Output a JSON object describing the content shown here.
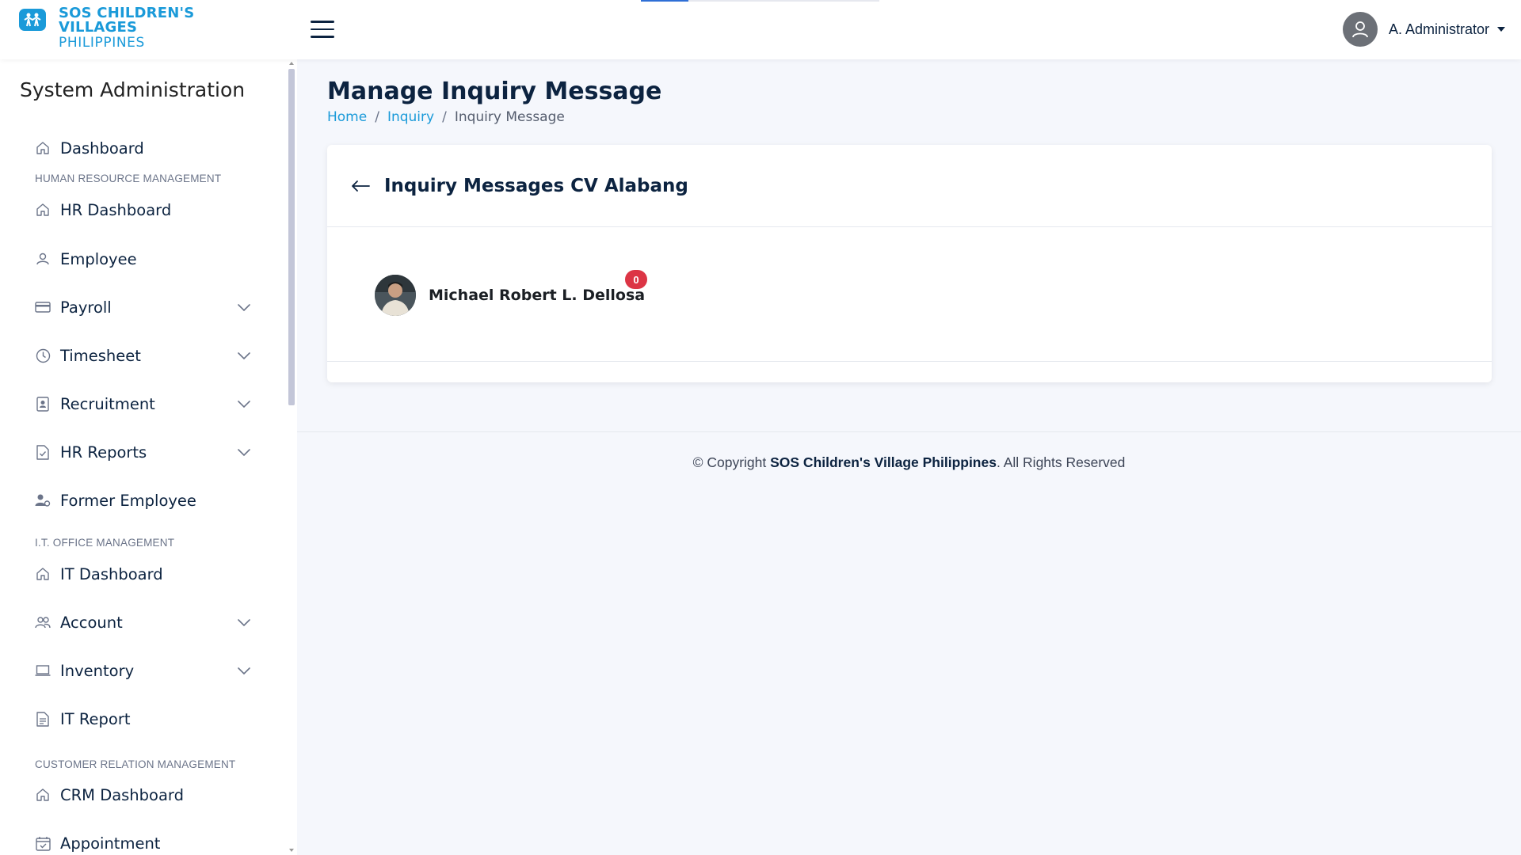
{
  "header": {
    "logo": {
      "line1": "SOS CHILDREN'S",
      "line2": "VILLAGES",
      "line3": "PHILIPPINES"
    },
    "user_name": "A. Administrator",
    "progress_fraction": 0.2
  },
  "sidebar": {
    "title": "System Administration",
    "items": [
      {
        "label": "Dashboard",
        "icon": "home-icon",
        "expandable": false
      },
      {
        "section": "HUMAN RESOURCE MANAGEMENT"
      },
      {
        "label": "HR Dashboard",
        "icon": "home-icon",
        "expandable": false
      },
      {
        "label": "Employee",
        "icon": "user-icon",
        "expandable": false
      },
      {
        "label": "Payroll",
        "icon": "credit-card-icon",
        "expandable": true
      },
      {
        "label": "Timesheet",
        "icon": "clock-icon",
        "expandable": true
      },
      {
        "label": "Recruitment",
        "icon": "id-badge-icon",
        "expandable": true
      },
      {
        "label": "HR Reports",
        "icon": "file-check-icon",
        "expandable": true
      },
      {
        "label": "Former Employee",
        "icon": "user-gear-icon",
        "expandable": false
      },
      {
        "section": "I.T. OFFICE MANAGEMENT"
      },
      {
        "label": "IT Dashboard",
        "icon": "home-icon",
        "expandable": false
      },
      {
        "label": "Account",
        "icon": "users-icon",
        "expandable": true
      },
      {
        "label": "Inventory",
        "icon": "laptop-icon",
        "expandable": true
      },
      {
        "label": "IT Report",
        "icon": "file-text-icon",
        "expandable": false
      },
      {
        "section": "CUSTOMER RELATION MANAGEMENT"
      },
      {
        "label": "CRM Dashboard",
        "icon": "home-icon",
        "expandable": false
      },
      {
        "label": "Appointment",
        "icon": "calendar-check-icon",
        "expandable": false
      }
    ]
  },
  "main": {
    "page_title": "Manage Inquiry Message",
    "breadcrumb": {
      "home": "Home",
      "inquiry": "Inquiry",
      "current": "Inquiry Message",
      "separator": "/"
    },
    "card": {
      "title": "Inquiry Messages CV Alabang",
      "inquiries": [
        {
          "name": "Michael Robert L. Dellosa",
          "unread": "0"
        }
      ]
    }
  },
  "footer": {
    "prefix": "© Copyright",
    "org": "SOS Children's Village Philippines",
    "suffix": ". All Rights Reserved"
  },
  "colors": {
    "brand_blue": "#1a9ad9",
    "navy_text": "#0c2340",
    "badge_red": "#dc3545",
    "page_bg": "#f5f7fc"
  }
}
